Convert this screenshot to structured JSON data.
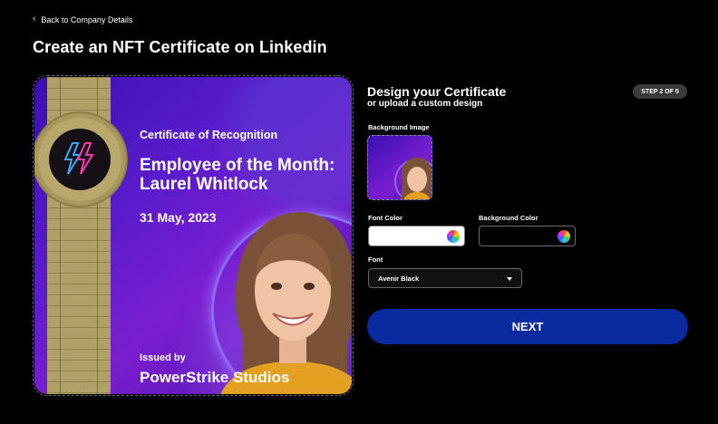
{
  "nav": {
    "back_label": "Back to Company Details"
  },
  "page": {
    "title": "Create an NFT Certificate on Linkedin"
  },
  "certificate": {
    "label": "Certificate of Recognition",
    "title": "Employee of the Month:",
    "name": "Laurel Whitlock",
    "date": "31 May, 2023",
    "issued_by_label": "Issued by",
    "issuer": "PowerStrike Studios"
  },
  "design": {
    "title": "Design your Certificate",
    "subtitle": "or upload a custom design",
    "step": "STEP 2 OF 5",
    "background_image_label": "Background Image",
    "font_color_label": "Font Color",
    "font_color_value": "#ffffff",
    "background_color_label": "Background Color",
    "background_color_value": "#000000",
    "font_label": "Font",
    "font_value": "Avenir Black",
    "next_label": "NEXT"
  },
  "colors": {
    "next_button": "#0a2ba0",
    "sash": "#b0a067",
    "certificate_bg": "#5a1ccc"
  }
}
